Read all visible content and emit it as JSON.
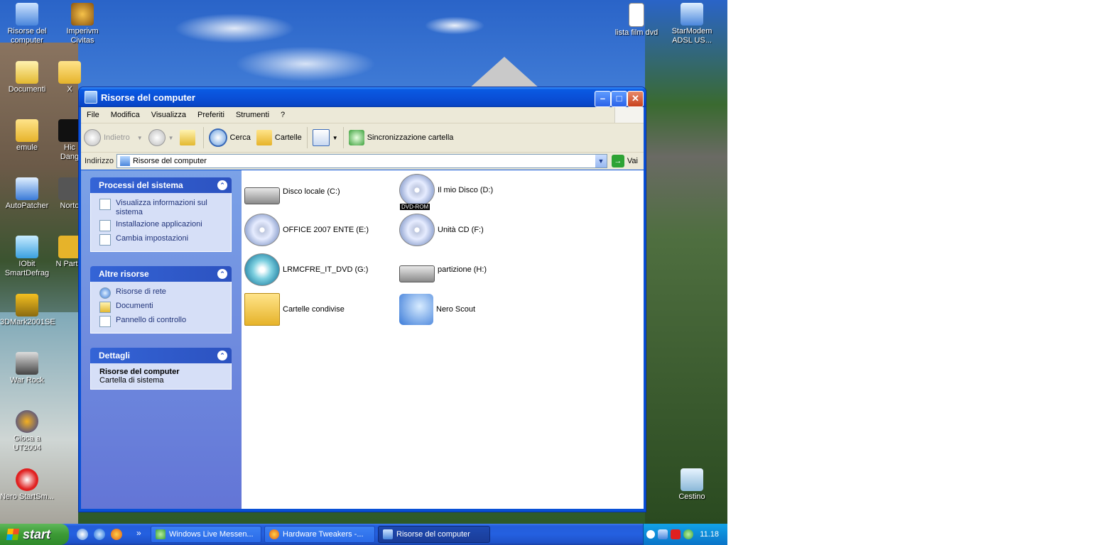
{
  "desktop": {
    "icons": [
      {
        "label": "Risorse del computer"
      },
      {
        "label": "Imperivm Civitas"
      },
      {
        "label": "Documenti"
      },
      {
        "label": "X"
      },
      {
        "label": "emule"
      },
      {
        "label": "Hic Dang"
      },
      {
        "label": "AutoPatcher"
      },
      {
        "label": "Norto"
      },
      {
        "label": "IObit SmartDefrag"
      },
      {
        "label": "N Partiti"
      },
      {
        "label": "3DMark2001SE"
      },
      {
        "label": "War Rock"
      },
      {
        "label": "Gioca a UT2004"
      },
      {
        "label": "Nero StartSm..."
      },
      {
        "label": "lista film dvd"
      },
      {
        "label": "StarModem ADSL US..."
      },
      {
        "label": "Cestino"
      }
    ]
  },
  "window": {
    "title": "Risorse del computer",
    "controls": {
      "minimize": "–",
      "maximize": "□",
      "close": "✕"
    },
    "menu": [
      "File",
      "Modifica",
      "Visualizza",
      "Preferiti",
      "Strumenti",
      "?"
    ],
    "toolbar": {
      "back": "Indietro",
      "search": "Cerca",
      "folders": "Cartelle",
      "sync": "Sincronizzazione cartella"
    },
    "address": {
      "label": "Indirizzo",
      "value": "Risorse del computer",
      "go": "Vai"
    }
  },
  "sidebar": {
    "system_tasks": {
      "title": "Processi del sistema",
      "items": [
        "Visualizza informazioni sul sistema",
        "Installazione applicazioni",
        "Cambia impostazioni"
      ]
    },
    "other_places": {
      "title": "Altre risorse",
      "items": [
        "Risorse di rete",
        "Documenti",
        "Pannello di controllo"
      ]
    },
    "details": {
      "title": "Dettagli",
      "name": "Risorse del computer",
      "desc": "Cartella di sistema"
    }
  },
  "content": {
    "items": [
      {
        "label": "Disco locale (C:)",
        "icon": "hard-drive-icon"
      },
      {
        "label": "Il mio Disco (D:)",
        "icon": "dvd-drive-icon",
        "badge": "DVD-ROM"
      },
      {
        "label": "OFFICE 2007 ENTE (E:)",
        "icon": "office-cd-icon"
      },
      {
        "label": "Unità CD (F:)",
        "icon": "cd-drive-icon"
      },
      {
        "label": "LRMCFRE_IT_DVD (G:)",
        "icon": "windows-dvd-icon"
      },
      {
        "label": "partizione (H:)",
        "icon": "hard-drive-icon"
      },
      {
        "label": "Cartelle condivise",
        "icon": "shared-folder-icon"
      },
      {
        "label": "Nero Scout",
        "icon": "nero-scout-icon"
      }
    ]
  },
  "taskbar": {
    "start": "start",
    "more": "»",
    "tasks": [
      {
        "label": "Windows Live Messen..."
      },
      {
        "label": "Hardware Tweakers -..."
      },
      {
        "label": "Risorse del computer"
      }
    ],
    "clock": "11.18"
  },
  "colors": {
    "title_bar": "#0a50d8",
    "sidebar": "#6d8ce0",
    "taskbar": "#245edb",
    "start_button": "#3c9a35",
    "tray": "#0d8bd8"
  }
}
